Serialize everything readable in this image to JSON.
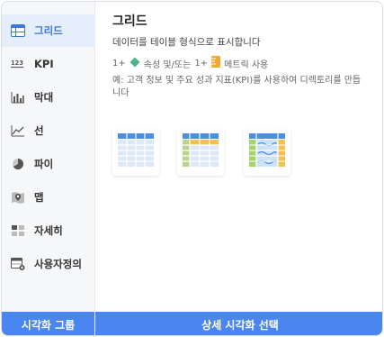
{
  "sidebar": {
    "items": [
      {
        "label": "그리드",
        "icon": "grid-table-icon"
      },
      {
        "label": "KPI",
        "icon": "kpi-123-icon"
      },
      {
        "label": "막대",
        "icon": "bar-chart-icon"
      },
      {
        "label": "선",
        "icon": "line-chart-icon"
      },
      {
        "label": "파이",
        "icon": "pie-chart-icon"
      },
      {
        "label": "맵",
        "icon": "map-pin-icon"
      },
      {
        "label": "자세히",
        "icon": "detail-blocks-icon"
      },
      {
        "label": "사용자정의",
        "icon": "custom-table-icon"
      }
    ]
  },
  "main": {
    "title": "그리드",
    "subtitle": "데이터를 테이블 형식으로 표시합니다",
    "requirements": {
      "count1": "1+",
      "attribute_text": "속성 및/또는",
      "count2": "1+",
      "metric_text": "메트릭 사용"
    },
    "example": "예: 고객 정보 및 주요 성과 지표(KPI)를 사용하여 디렉토리를 만듭니다",
    "thumbnails": [
      "grid-style-basic-icon",
      "grid-style-banded-icon",
      "grid-style-colored-icon"
    ]
  },
  "footer": {
    "left": "시각화 그룹",
    "right": "상세 시각화 선택"
  },
  "colors": {
    "accent": "#4a86f0",
    "active_bg": "#e6eefb",
    "attribute": "#4cb58c",
    "metric": "#f0a830"
  }
}
